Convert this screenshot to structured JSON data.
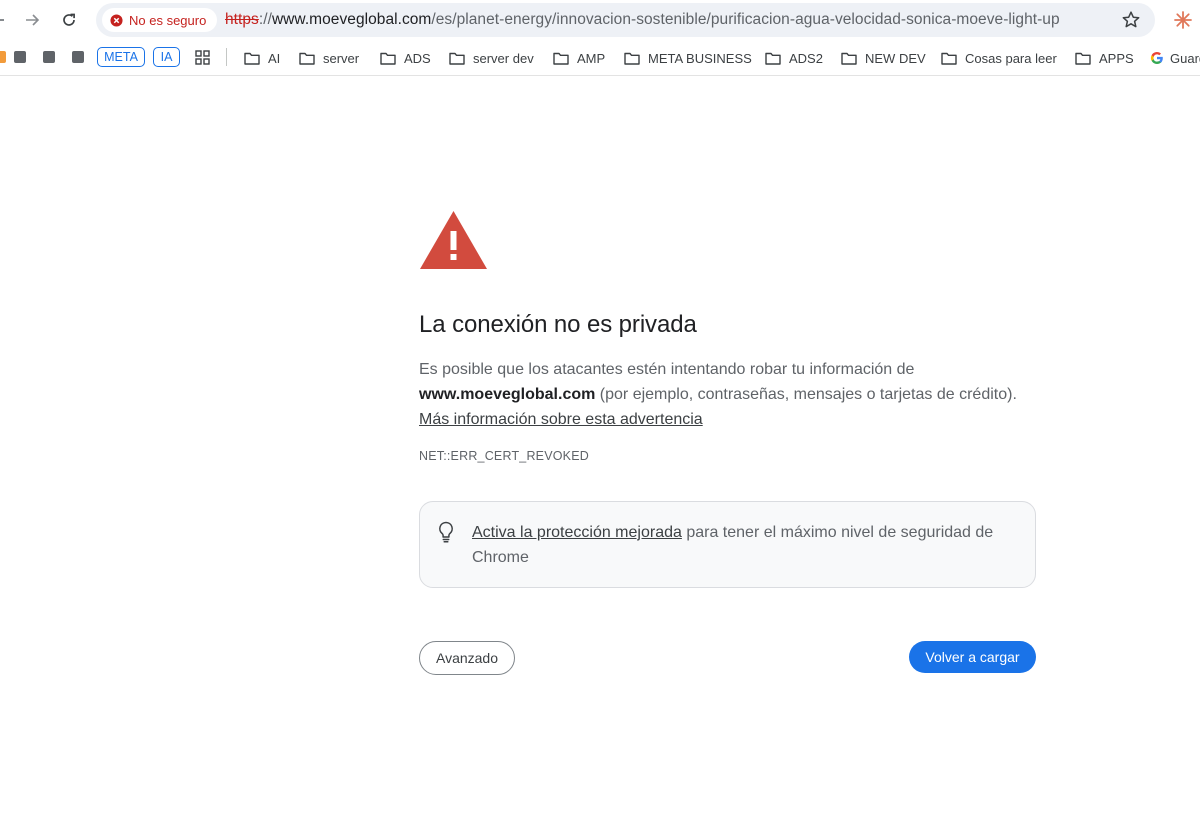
{
  "browser": {
    "security_chip_label": "No es seguro",
    "url": {
      "scheme": "https",
      "separator": "://",
      "host": "www.moeveglobal.com",
      "path": "/es/planet-energy/innovacion-sostenible/purificacion-agua-velocidad-sonica-moeve-light-up"
    },
    "colors": {
      "insecure_red": "#c5221f",
      "omnibox_bg": "#eef1f6",
      "accent_blue": "#1a73e8"
    }
  },
  "bookmarks": {
    "pills": [
      "META",
      "IA"
    ],
    "folders": [
      "AI",
      "server",
      "ADS",
      "server dev",
      "AMP",
      "META BUSINESS",
      "ADS2",
      "NEW DEV",
      "Cosas para leer",
      "APPS"
    ],
    "last_item": "Guard"
  },
  "interstitial": {
    "heading": "La conexión no es privada",
    "explanation_prefix": "Es posible que los atacantes estén intentando robar tu información de",
    "domain": "www.moeveglobal.com",
    "explanation_suffix": " (por ejemplo, contraseñas, mensajes o tarjetas de crédito).",
    "learn_more": "Más información sobre esta advertencia",
    "error_code": "NET::ERR_CERT_REVOKED",
    "enhanced_protection_link": "Activa la protección mejorada",
    "enhanced_protection_text": " para tener el máximo nivel de seguridad de Chrome",
    "advanced_button": "Avanzado",
    "reload_button": "Volver a cargar",
    "warning_color": "#d24b3e"
  }
}
